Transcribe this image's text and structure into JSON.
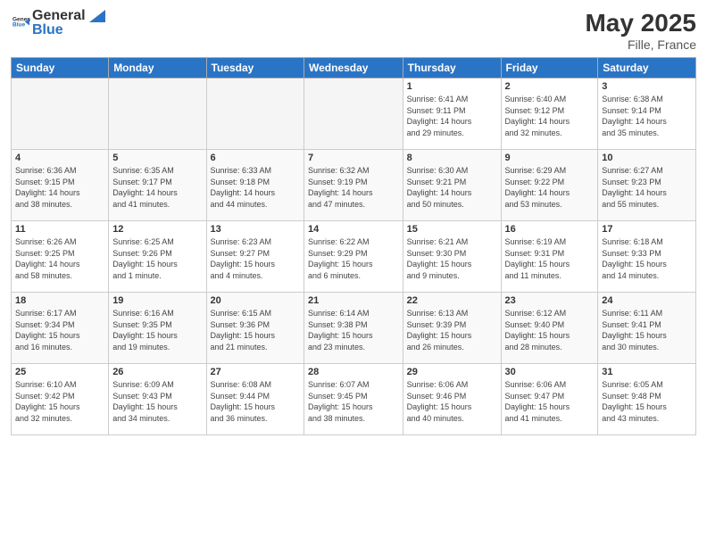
{
  "header": {
    "logo_general": "General",
    "logo_blue": "Blue",
    "title": "May 2025",
    "subtitle": "Fille, France"
  },
  "weekdays": [
    "Sunday",
    "Monday",
    "Tuesday",
    "Wednesday",
    "Thursday",
    "Friday",
    "Saturday"
  ],
  "weeks": [
    [
      {
        "day": "",
        "info": ""
      },
      {
        "day": "",
        "info": ""
      },
      {
        "day": "",
        "info": ""
      },
      {
        "day": "",
        "info": ""
      },
      {
        "day": "1",
        "info": "Sunrise: 6:41 AM\nSunset: 9:11 PM\nDaylight: 14 hours\nand 29 minutes."
      },
      {
        "day": "2",
        "info": "Sunrise: 6:40 AM\nSunset: 9:12 PM\nDaylight: 14 hours\nand 32 minutes."
      },
      {
        "day": "3",
        "info": "Sunrise: 6:38 AM\nSunset: 9:14 PM\nDaylight: 14 hours\nand 35 minutes."
      }
    ],
    [
      {
        "day": "4",
        "info": "Sunrise: 6:36 AM\nSunset: 9:15 PM\nDaylight: 14 hours\nand 38 minutes."
      },
      {
        "day": "5",
        "info": "Sunrise: 6:35 AM\nSunset: 9:17 PM\nDaylight: 14 hours\nand 41 minutes."
      },
      {
        "day": "6",
        "info": "Sunrise: 6:33 AM\nSunset: 9:18 PM\nDaylight: 14 hours\nand 44 minutes."
      },
      {
        "day": "7",
        "info": "Sunrise: 6:32 AM\nSunset: 9:19 PM\nDaylight: 14 hours\nand 47 minutes."
      },
      {
        "day": "8",
        "info": "Sunrise: 6:30 AM\nSunset: 9:21 PM\nDaylight: 14 hours\nand 50 minutes."
      },
      {
        "day": "9",
        "info": "Sunrise: 6:29 AM\nSunset: 9:22 PM\nDaylight: 14 hours\nand 53 minutes."
      },
      {
        "day": "10",
        "info": "Sunrise: 6:27 AM\nSunset: 9:23 PM\nDaylight: 14 hours\nand 55 minutes."
      }
    ],
    [
      {
        "day": "11",
        "info": "Sunrise: 6:26 AM\nSunset: 9:25 PM\nDaylight: 14 hours\nand 58 minutes."
      },
      {
        "day": "12",
        "info": "Sunrise: 6:25 AM\nSunset: 9:26 PM\nDaylight: 15 hours\nand 1 minute."
      },
      {
        "day": "13",
        "info": "Sunrise: 6:23 AM\nSunset: 9:27 PM\nDaylight: 15 hours\nand 4 minutes."
      },
      {
        "day": "14",
        "info": "Sunrise: 6:22 AM\nSunset: 9:29 PM\nDaylight: 15 hours\nand 6 minutes."
      },
      {
        "day": "15",
        "info": "Sunrise: 6:21 AM\nSunset: 9:30 PM\nDaylight: 15 hours\nand 9 minutes."
      },
      {
        "day": "16",
        "info": "Sunrise: 6:19 AM\nSunset: 9:31 PM\nDaylight: 15 hours\nand 11 minutes."
      },
      {
        "day": "17",
        "info": "Sunrise: 6:18 AM\nSunset: 9:33 PM\nDaylight: 15 hours\nand 14 minutes."
      }
    ],
    [
      {
        "day": "18",
        "info": "Sunrise: 6:17 AM\nSunset: 9:34 PM\nDaylight: 15 hours\nand 16 minutes."
      },
      {
        "day": "19",
        "info": "Sunrise: 6:16 AM\nSunset: 9:35 PM\nDaylight: 15 hours\nand 19 minutes."
      },
      {
        "day": "20",
        "info": "Sunrise: 6:15 AM\nSunset: 9:36 PM\nDaylight: 15 hours\nand 21 minutes."
      },
      {
        "day": "21",
        "info": "Sunrise: 6:14 AM\nSunset: 9:38 PM\nDaylight: 15 hours\nand 23 minutes."
      },
      {
        "day": "22",
        "info": "Sunrise: 6:13 AM\nSunset: 9:39 PM\nDaylight: 15 hours\nand 26 minutes."
      },
      {
        "day": "23",
        "info": "Sunrise: 6:12 AM\nSunset: 9:40 PM\nDaylight: 15 hours\nand 28 minutes."
      },
      {
        "day": "24",
        "info": "Sunrise: 6:11 AM\nSunset: 9:41 PM\nDaylight: 15 hours\nand 30 minutes."
      }
    ],
    [
      {
        "day": "25",
        "info": "Sunrise: 6:10 AM\nSunset: 9:42 PM\nDaylight: 15 hours\nand 32 minutes."
      },
      {
        "day": "26",
        "info": "Sunrise: 6:09 AM\nSunset: 9:43 PM\nDaylight: 15 hours\nand 34 minutes."
      },
      {
        "day": "27",
        "info": "Sunrise: 6:08 AM\nSunset: 9:44 PM\nDaylight: 15 hours\nand 36 minutes."
      },
      {
        "day": "28",
        "info": "Sunrise: 6:07 AM\nSunset: 9:45 PM\nDaylight: 15 hours\nand 38 minutes."
      },
      {
        "day": "29",
        "info": "Sunrise: 6:06 AM\nSunset: 9:46 PM\nDaylight: 15 hours\nand 40 minutes."
      },
      {
        "day": "30",
        "info": "Sunrise: 6:06 AM\nSunset: 9:47 PM\nDaylight: 15 hours\nand 41 minutes."
      },
      {
        "day": "31",
        "info": "Sunrise: 6:05 AM\nSunset: 9:48 PM\nDaylight: 15 hours\nand 43 minutes."
      }
    ]
  ]
}
